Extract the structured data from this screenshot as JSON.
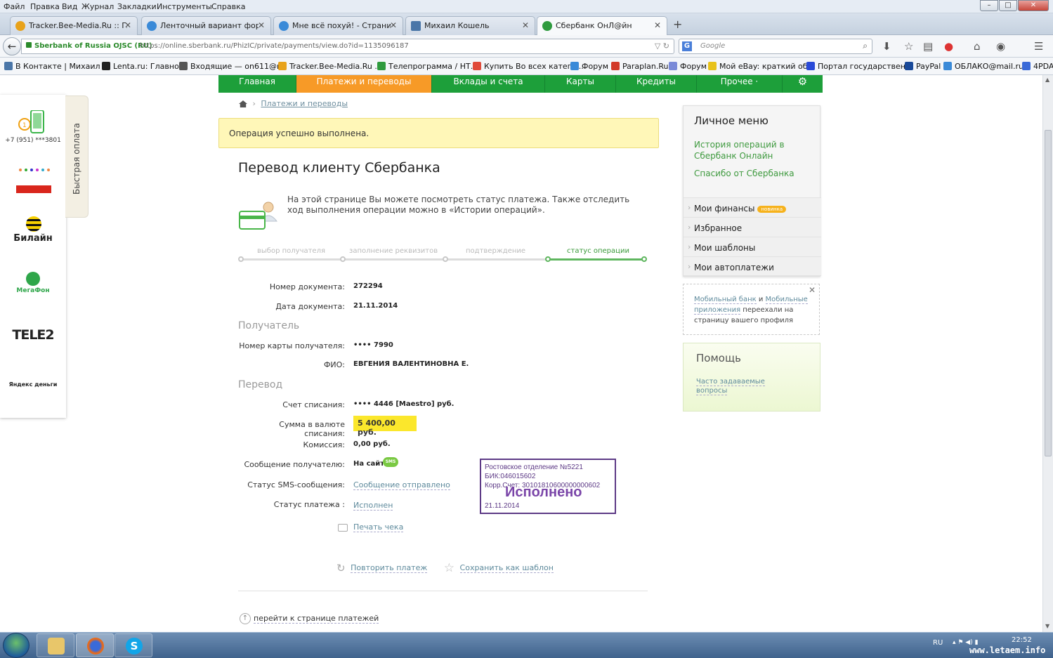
{
  "browser": {
    "menu": [
      "Файл",
      "Правка",
      "Вид",
      "Журнал",
      "Закладки",
      "Инструменты",
      "Справка"
    ],
    "tabs": [
      {
        "label": "Tracker.Bee-Media.Ru :: Гл...",
        "color": "#e8a21a"
      },
      {
        "label": "Ленточный вариант фору...",
        "color": "#3a8ad8"
      },
      {
        "label": "Мне всё похуй! - Страниц...",
        "color": "#3a8ad8"
      },
      {
        "label": "Михаил Кошель",
        "color": "#4a76a8"
      },
      {
        "label": "Сбербанк ОнЛ@йн",
        "color": "#2e9a3e"
      }
    ],
    "new_tab": "+",
    "site_identity": "Sberbank of Russia OJSC (RU)",
    "url": "https://online.sberbank.ru/PhizIC/private/payments/view.do?id=1135096187",
    "search_placeholder": "Google",
    "bookmarks": [
      {
        "label": "В Контакте | Михаил ...",
        "color": "#4a76a8"
      },
      {
        "label": "Lenta.ru: Главное:",
        "color": "#222"
      },
      {
        "label": "Входящие — on611@r...",
        "color": "#555"
      },
      {
        "label": "Tracker.Bee-Media.Ru ...",
        "color": "#e8a21a"
      },
      {
        "label": "Телепрограмма / НТ...",
        "color": "#2e9a3e"
      },
      {
        "label": "Купить Во всех катего...",
        "color": "#e04a3a"
      },
      {
        "label": "Форум",
        "color": "#3a8ad8"
      },
      {
        "label": "Paraplan.Ru",
        "color": "#d23a2a"
      },
      {
        "label": "Форум",
        "color": "#7a8ad8"
      },
      {
        "label": "Мой eBay: краткий об...",
        "color": "#e8c21a"
      },
      {
        "label": "Портал государствен...",
        "color": "#2a4ad8"
      },
      {
        "label": "PayPal",
        "color": "#1a4a9a"
      },
      {
        "label": "ОБЛАКО@mail.ru",
        "color": "#3a8ad8"
      },
      {
        "label": "4PDA",
        "color": "#3a6ad8"
      }
    ]
  },
  "quick_pay": {
    "tab_label": "Быстрая оплата",
    "phone": "+7 (951) ***3801",
    "providers": [
      "Билайн",
      "МегаФон",
      "TELE2",
      "Яндекс деньги"
    ]
  },
  "nav": {
    "items": [
      "Главная",
      "Платежи и переводы",
      "Вклады и счета",
      "Карты",
      "Кредиты",
      "Прочее ·"
    ],
    "active_index": 1,
    "settings_icon": "gear-icon"
  },
  "breadcrumb": {
    "link": "Платежи и переводы"
  },
  "notice": "Операция успешно выполнена.",
  "page_title": "Перевод клиенту Сбербанка",
  "info_text": "На этой странице Вы можете посмотреть статус платежа. Также отследить ход выполнения операции можно в «Истории операций».",
  "steps": [
    "выбор получателя",
    "заполнение реквизитов",
    "подтверждение",
    "статус операции"
  ],
  "details": {
    "doc_number_label": "Номер документа:",
    "doc_number": "272294",
    "doc_date_label": "Дата документа:",
    "doc_date": "21.11.2014",
    "recipient_section": "Получатель",
    "card_label": "Номер карты получателя:",
    "card": "•••• 7990",
    "name_label": "ФИО:",
    "name": "ЕВГЕНИЯ ВАЛЕНТИНОВНА Е.",
    "transfer_section": "Перевод",
    "account_label": "Счет списания:",
    "account": "•••• 4446  [Maestro]  руб.",
    "amount_label": "Сумма в валюте списания:",
    "amount": "5 400,00   руб.",
    "fee_label": "Комиссия:",
    "fee": "0,00 руб.",
    "message_label": "Сообщение получателю:",
    "message": "На сайт",
    "sms_badge": "SMS",
    "sms_status_label": "Статус SMS-сообщения:",
    "sms_status": "Сообщение отправлено",
    "payment_status_label": "Статус платежа :",
    "payment_status": "Исполнен"
  },
  "stamp": {
    "line1": "Ростовское отделение №5221",
    "line2": "БИК:046015602",
    "line3": "Корр.Счет: 30101810600000000602",
    "big": "Исполнено",
    "date": "21.11.2014"
  },
  "actions": {
    "print": "Печать чека",
    "repeat": "Повторить платеж",
    "save_template": "Сохранить как шаблон"
  },
  "back_link": "перейти к странице платежей",
  "personal_menu": {
    "title": "Личное меню",
    "link1": "История операций в Сбербанк Онлайн",
    "link2": "Спасибо от Сбербанка",
    "items": [
      "Мои финансы",
      "Избранное",
      "Мои шаблоны",
      "Мои автоплатежи"
    ],
    "badge": "новинка"
  },
  "mobile_note": {
    "link1": "Мобильный банк",
    "and": " и ",
    "link2": "Мобильные приложения",
    "rest": " переехали на страницу вашего профиля"
  },
  "help": {
    "title": "Помощь",
    "link": "Часто задаваемые вопросы"
  },
  "taskbar": {
    "lang": "RU",
    "clock": "22:52",
    "watermark": "www.letaem.info"
  },
  "colors": {
    "brand_green": "#1d9f3a",
    "active_orange": "#f79a27",
    "notice_yellow": "#fff7b8",
    "amount_yellow": "#fbe72c",
    "stamp_purple": "#5d3a86"
  }
}
